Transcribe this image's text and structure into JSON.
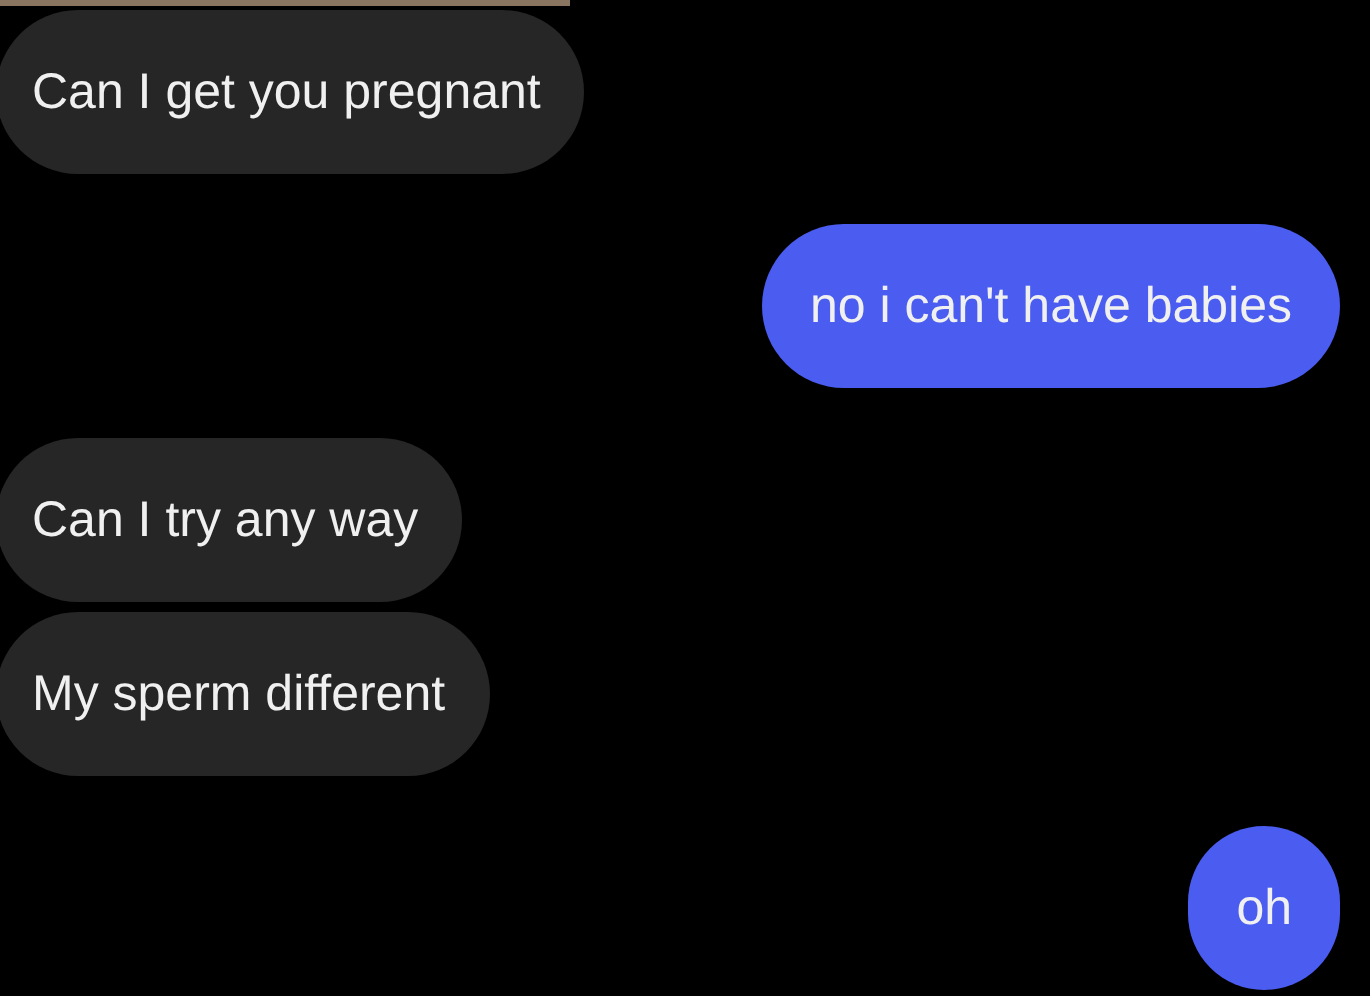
{
  "messages": [
    {
      "kind": "incoming",
      "text": "Can I get you pregnant"
    },
    {
      "kind": "outgoing",
      "text": "no i can't have babies"
    },
    {
      "kind": "incoming",
      "text": "Can I try any way"
    },
    {
      "kind": "incoming",
      "text": "My sperm different"
    },
    {
      "kind": "outgoing",
      "text": "oh"
    }
  ]
}
